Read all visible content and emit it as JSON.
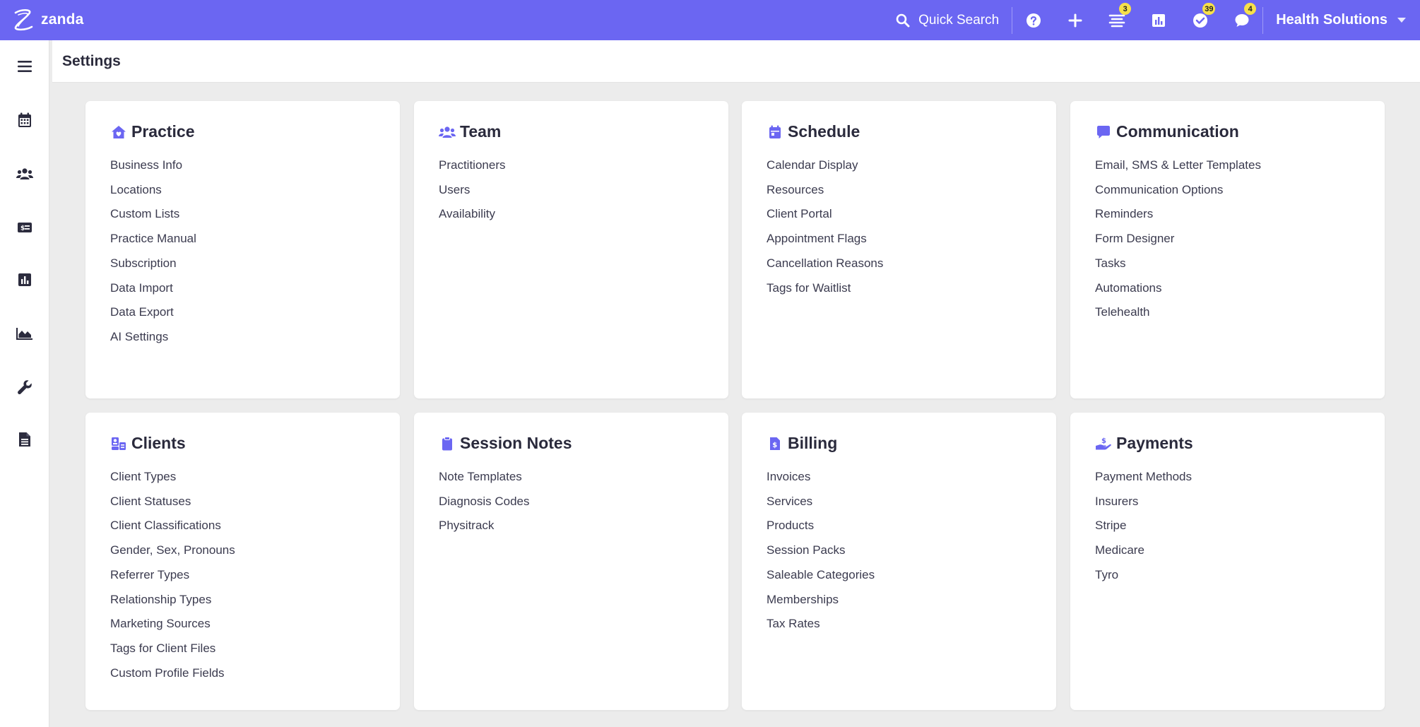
{
  "topbar": {
    "logo_text": "zanda",
    "search_label": "Quick Search",
    "badges": {
      "tasks_list": "3",
      "todos": "39",
      "messages": "4"
    },
    "account_name": "Health Solutions"
  },
  "page": {
    "title": "Settings"
  },
  "colors": {
    "accent": "#6b66f2",
    "badge": "#f7e04a",
    "background": "#ececec"
  },
  "cards": [
    {
      "title": "Practice",
      "icon": "home-heart-icon",
      "links": [
        "Business Info",
        "Locations",
        "Custom Lists",
        "Practice Manual",
        "Subscription",
        "Data Import",
        "Data Export",
        "AI Settings"
      ]
    },
    {
      "title": "Team",
      "icon": "users-icon",
      "links": [
        "Practitioners",
        "Users",
        "Availability"
      ]
    },
    {
      "title": "Schedule",
      "icon": "calendar-icon",
      "links": [
        "Calendar Display",
        "Resources",
        "Client Portal",
        "Appointment Flags",
        "Cancellation Reasons",
        "Tags for Waitlist"
      ]
    },
    {
      "title": "Communication",
      "icon": "chat-bubble-icon",
      "links": [
        "Email, SMS & Letter Templates",
        "Communication Options",
        "Reminders",
        "Form Designer",
        "Tasks",
        "Automations",
        "Telehealth"
      ]
    },
    {
      "title": "Clients",
      "icon": "client-card-icon",
      "links": [
        "Client Types",
        "Client Statuses",
        "Client Classifications",
        "Gender, Sex, Pronouns",
        "Referrer Types",
        "Relationship Types",
        "Marketing Sources",
        "Tags for Client Files",
        "Custom Profile Fields"
      ]
    },
    {
      "title": "Session Notes",
      "icon": "clipboard-icon",
      "links": [
        "Note Templates",
        "Diagnosis Codes",
        "Physitrack"
      ]
    },
    {
      "title": "Billing",
      "icon": "invoice-dollar-icon",
      "links": [
        "Invoices",
        "Services",
        "Products",
        "Session Packs",
        "Saleable Categories",
        "Memberships",
        "Tax Rates"
      ]
    },
    {
      "title": "Payments",
      "icon": "hand-dollar-icon",
      "links": [
        "Payment Methods",
        "Insurers",
        "Stripe",
        "Medicare",
        "Tyro"
      ]
    }
  ]
}
